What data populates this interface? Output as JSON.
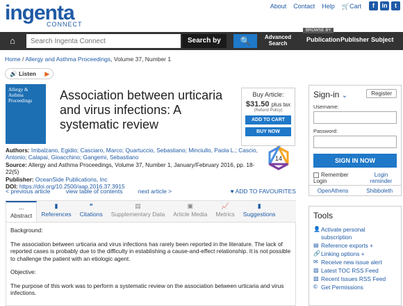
{
  "header": {
    "logo_main": "ingenta",
    "logo_sub": "CONNECT",
    "links": [
      "About",
      "Contact",
      "Help",
      "Cart"
    ]
  },
  "nav": {
    "search_placeholder": "Search Ingenta Connect",
    "search_by": "Search by",
    "advanced": "Advanced Search",
    "browse_by": "BROWSE BY",
    "browse": [
      "Publication",
      "Publisher",
      "Subject"
    ]
  },
  "breadcrumb": {
    "home": "Home",
    "journal": "Allergy and Asthma Proceedings",
    "rest": ", Volume 37, Number 1"
  },
  "listen_label": "Listen",
  "cover_text": "Allergy & Asthma Proceedings",
  "article": {
    "title": "Association between urticaria and virus infections: A systematic review",
    "authors_label": "Authors:",
    "authors": "Imbalzano, Egidio; Casciaro, Marco; Quartuccio, Sebastiano; Minciullo, Paola L.; Cascio, Antonio; Calapai, Gioacchino; Gangemi, Sebastiano",
    "source_label": "Source:",
    "source": "Allergy and Asthma Proceedings, Volume 37, Number 1, January/February 2016, pp. 18-22(5)",
    "publisher_label": "Publisher:",
    "publisher": "OceanSide Publications, Inc",
    "doi_label": "DOI:",
    "doi": "https://doi.org/10.2500/aap.2016.37.3915",
    "badge": "14"
  },
  "buy": {
    "label": "Buy Article:",
    "price": "$31.50",
    "tax": "plus tax",
    "refund": "(Refund Policy)",
    "add_to_cart": "ADD TO CART",
    "buy_now": "BUY NOW"
  },
  "article_nav": {
    "prev": "< previous article",
    "toc": "view table of contents",
    "next": "next article >",
    "fav": "ADD TO FAVOURITES"
  },
  "tabs": [
    {
      "icon": "...",
      "label": "Abstract"
    },
    {
      "icon": "▮",
      "label": "References"
    },
    {
      "icon": "❝",
      "label": "Citations"
    },
    {
      "icon": "▤",
      "label": "Supplementary Data"
    },
    {
      "icon": "▣",
      "label": "Article Media"
    },
    {
      "icon": "📈",
      "label": "Metrics"
    },
    {
      "icon": "▮",
      "label": "Suggestions"
    }
  ],
  "abstract": {
    "p1": "Background:",
    "p2": "The association between urticaria and virus infections has rarely been reported in the literature. The lack of reported cases is probably due to the difficulty in establishing a cause-and-effect relationship. It is not possible to challenge the patient with an etiologic agent.",
    "p3": "Objective:",
    "p4": "The purpose of this work was to perform a systematic review on the association between urticaria and virus infections."
  },
  "signin": {
    "title": "Sign-in",
    "register": "Register",
    "username": "Username:",
    "password": "Password:",
    "button": "SIGN IN NOW",
    "remember": "Remember Login",
    "reminder": "Login reminder",
    "openathens": "OpenAthens",
    "shibboleth": "Shibboleth"
  },
  "tools": {
    "title": "Tools",
    "items": [
      "Activate personal subscription",
      "Reference exports +",
      "Linking options +",
      "Receive new issue alert",
      "Latest TOC RSS Feed",
      "Recent Issues RSS Feed",
      "Get Permissions"
    ]
  },
  "colors": {
    "brand": "#1f5aa6",
    "button": "#1f78c8",
    "navbar": "#333333"
  }
}
